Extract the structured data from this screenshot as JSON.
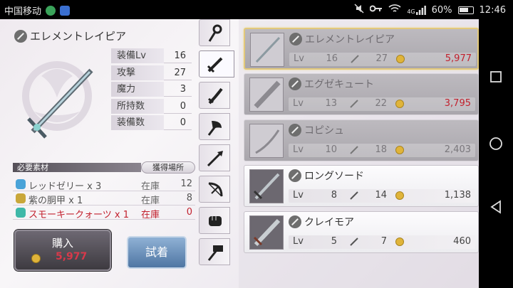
{
  "statusbar": {
    "carrier": "中国移动",
    "signal_label": "4G",
    "battery": "60%",
    "time": "12:46"
  },
  "item": {
    "name": "エレメントレイピア",
    "stats": [
      {
        "label": "装備Lv",
        "value": "16"
      },
      {
        "label": "攻撃",
        "value": "27"
      },
      {
        "label": "魔力",
        "value": "3"
      },
      {
        "label": "所持数",
        "value": "0"
      },
      {
        "label": "装備数",
        "value": "0"
      }
    ]
  },
  "materials": {
    "heading": "必要素材",
    "obtain_button": "獲得場所",
    "rows": [
      {
        "name": "レッドゼリー x 3",
        "stock_label": "在庫",
        "qty": "12",
        "icon_color": "#4aa3d8",
        "insufficient": false
      },
      {
        "name": "紫の胴甲 x 1",
        "stock_label": "在庫",
        "qty": "8",
        "icon_color": "#c9a73a",
        "insufficient": false
      },
      {
        "name": "スモーキークォーツ x 1",
        "stock_label": "在庫",
        "qty": "0",
        "icon_color": "#3fb8a8",
        "insufficient": true
      }
    ]
  },
  "buy": {
    "label": "購入",
    "price": "5,977"
  },
  "try_button": "試着",
  "tabs": [
    "staff-icon",
    "sword-icon",
    "katana-icon",
    "axe-icon",
    "spear-icon",
    "bow-icon",
    "fist-icon",
    "hammer-icon"
  ],
  "weapons": [
    {
      "name": "エレメントレイピア",
      "lv_label": "Lv",
      "lv": "16",
      "atk": "27",
      "price": "5,977",
      "affordable": false,
      "selected": true
    },
    {
      "name": "エグゼキュート",
      "lv_label": "Lv",
      "lv": "13",
      "atk": "22",
      "price": "3,795",
      "affordable": false,
      "selected": false
    },
    {
      "name": "コピシュ",
      "lv_label": "Lv",
      "lv": "10",
      "atk": "18",
      "price": "2,403",
      "affordable": true,
      "dim": true,
      "selected": false
    },
    {
      "name": "ロングソード",
      "lv_label": "Lv",
      "lv": "8",
      "atk": "14",
      "price": "1,138",
      "affordable": true,
      "selected": false
    },
    {
      "name": "クレイモア",
      "lv_label": "Lv",
      "lv": "5",
      "atk": "7",
      "price": "460",
      "affordable": true,
      "selected": false
    }
  ]
}
